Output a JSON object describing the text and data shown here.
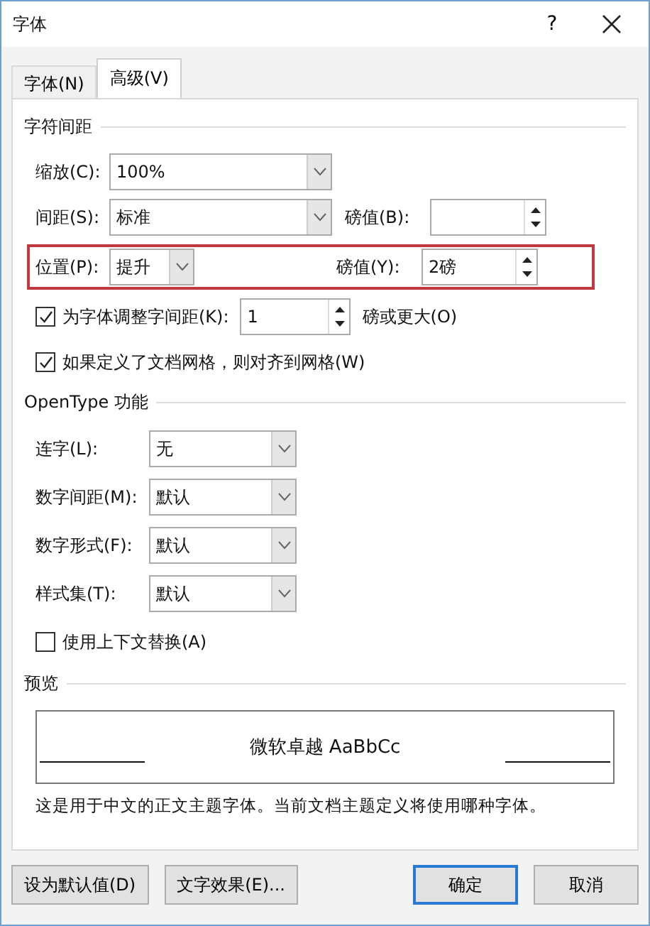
{
  "window": {
    "title": "字体",
    "help": "?"
  },
  "tabs": [
    {
      "label": "字体(N)",
      "selected": false
    },
    {
      "label": "高级(V)",
      "selected": true
    }
  ],
  "character_spacing": {
    "title": "字符间距",
    "rows": [
      {
        "kind": "combo",
        "label": "缩放(C):",
        "value": "100%"
      },
      {
        "kind": "combo",
        "label": "间距(S):",
        "value": "标准",
        "side": {
          "label": "磅值(B):"
        }
      },
      {
        "kind": "small-combo",
        "label": "位置(P):",
        "value": "提升",
        "highlighted": true,
        "side": {
          "label": "磅值(Y):",
          "value": "2磅"
        }
      },
      {
        "kind": "check-spin",
        "label": "为字体调整字间距(K):",
        "checked": true,
        "value": "1",
        "suffix": "磅或更大(O)"
      },
      {
        "kind": "check",
        "label": "如果定义了文档网格，则对齐到网格(W)",
        "checked": true
      }
    ]
  },
  "opentype": {
    "title": "OpenType 功能",
    "rows": [
      {
        "kind": "combo",
        "label": "连字(L):",
        "value": "无"
      },
      {
        "kind": "combo",
        "label": "数字间距(M):",
        "value": "默认"
      },
      {
        "kind": "combo",
        "label": "数字形式(F):",
        "value": "默认"
      },
      {
        "kind": "combo",
        "label": "样式集(T):",
        "value": "默认"
      },
      {
        "kind": "check",
        "label": "使用上下文替换(A)",
        "checked": false
      }
    ]
  },
  "preview": {
    "title": "预览",
    "sample": "微软卓越  AaBbCc",
    "description": "这是用于中文的正文主题字体。当前文档主题定义将使用哪种字体。"
  },
  "buttons": [
    {
      "label": "设为默认值(D)",
      "default": false
    },
    {
      "label": "文字效果(E)...",
      "default": false
    },
    {
      "label": "确定",
      "default": true
    },
    {
      "label": "取消",
      "default": false
    }
  ]
}
